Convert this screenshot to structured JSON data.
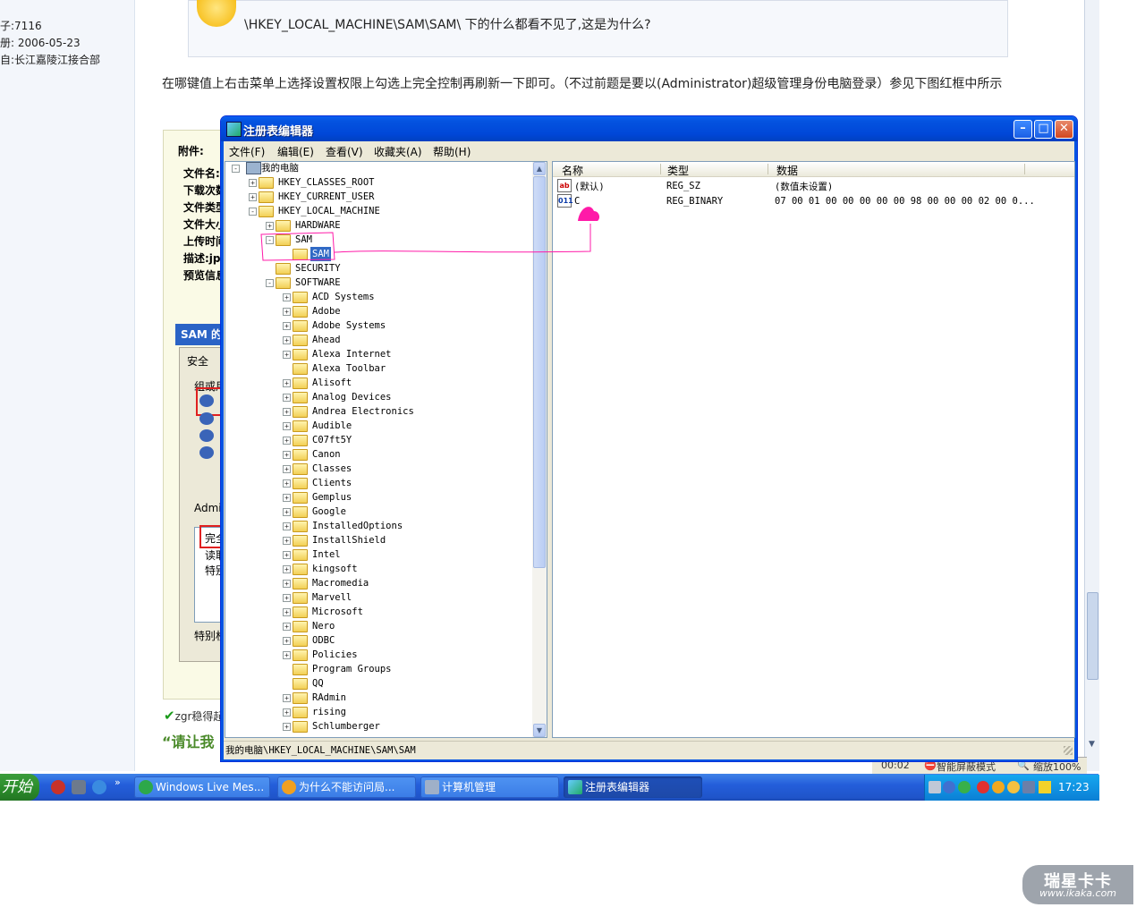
{
  "forum": {
    "user_meta": [
      "子:7116",
      "册: 2006-05-23",
      "自:长江嘉陵江接合部"
    ],
    "quote_text": "\\HKEY_LOCAL_MACHINE\\SAM\\SAM\\ 下的什么都看不见了,这是为什么?",
    "answer_text": "在哪键值上右击菜单上选择设置权限上勾选上完全控制再刷新一下即可。（不过前题是要以(Administrator)超级管理身份电脑登录）参见下图红框中所示",
    "attach_header": "附件:",
    "attach_labels": [
      "文件名:",
      "下载次数",
      "文件类型",
      "文件大小",
      "上传时间",
      "描述:jp",
      "预览信息"
    ],
    "sam_props_title": "SAM 的",
    "sam_tab": "安全",
    "sam_group": "组或用",
    "sam_admin": "Admin",
    "sam_perms": [
      "完全",
      "读取",
      "特别"
    ],
    "sam_special": "特别权",
    "reply_text": "zgr稳得起",
    "green_quote": "“请让我"
  },
  "ie_status": {
    "time": "00:02",
    "mode": "智能屏蔽模式",
    "zoom": "缩放100%"
  },
  "taskbar": {
    "start": "开始",
    "buttons": [
      {
        "label": "Windows Live Mes..."
      },
      {
        "label": "为什么不能访问局..."
      },
      {
        "label": "计算机管理"
      },
      {
        "label": "注册表编辑器"
      }
    ],
    "clock": "17:23"
  },
  "regedit": {
    "title": "注册表编辑器",
    "menu": [
      "文件(F)",
      "编辑(E)",
      "查看(V)",
      "收藏夹(A)",
      "帮助(H)"
    ],
    "tree": [
      {
        "label": "我的电脑",
        "depth": 0,
        "exp": "-"
      },
      {
        "label": "HKEY_CLASSES_ROOT",
        "depth": 1,
        "exp": "+"
      },
      {
        "label": "HKEY_CURRENT_USER",
        "depth": 1,
        "exp": "+"
      },
      {
        "label": "HKEY_LOCAL_MACHINE",
        "depth": 1,
        "exp": "-"
      },
      {
        "label": "HARDWARE",
        "depth": 2,
        "exp": "+"
      },
      {
        "label": "SAM",
        "depth": 2,
        "exp": "-"
      },
      {
        "label": "SAM",
        "depth": 3,
        "exp": "",
        "selected": true
      },
      {
        "label": "SECURITY",
        "depth": 2,
        "exp": ""
      },
      {
        "label": "SOFTWARE",
        "depth": 2,
        "exp": "-"
      },
      {
        "label": "ACD Systems",
        "depth": 3,
        "exp": "+"
      },
      {
        "label": "Adobe",
        "depth": 3,
        "exp": "+"
      },
      {
        "label": "Adobe Systems",
        "depth": 3,
        "exp": "+"
      },
      {
        "label": "Ahead",
        "depth": 3,
        "exp": "+"
      },
      {
        "label": "Alexa Internet",
        "depth": 3,
        "exp": "+"
      },
      {
        "label": "Alexa Toolbar",
        "depth": 3,
        "exp": ""
      },
      {
        "label": "Alisoft",
        "depth": 3,
        "exp": "+"
      },
      {
        "label": "Analog Devices",
        "depth": 3,
        "exp": "+"
      },
      {
        "label": "Andrea Electronics",
        "depth": 3,
        "exp": "+"
      },
      {
        "label": "Audible",
        "depth": 3,
        "exp": "+"
      },
      {
        "label": "C07ft5Y",
        "depth": 3,
        "exp": "+"
      },
      {
        "label": "Canon",
        "depth": 3,
        "exp": "+"
      },
      {
        "label": "Classes",
        "depth": 3,
        "exp": "+"
      },
      {
        "label": "Clients",
        "depth": 3,
        "exp": "+"
      },
      {
        "label": "Gemplus",
        "depth": 3,
        "exp": "+"
      },
      {
        "label": "Google",
        "depth": 3,
        "exp": "+"
      },
      {
        "label": "InstalledOptions",
        "depth": 3,
        "exp": "+"
      },
      {
        "label": "InstallShield",
        "depth": 3,
        "exp": "+"
      },
      {
        "label": "Intel",
        "depth": 3,
        "exp": "+"
      },
      {
        "label": "kingsoft",
        "depth": 3,
        "exp": "+"
      },
      {
        "label": "Macromedia",
        "depth": 3,
        "exp": "+"
      },
      {
        "label": "Marvell",
        "depth": 3,
        "exp": "+"
      },
      {
        "label": "Microsoft",
        "depth": 3,
        "exp": "+"
      },
      {
        "label": "Nero",
        "depth": 3,
        "exp": "+"
      },
      {
        "label": "ODBC",
        "depth": 3,
        "exp": "+"
      },
      {
        "label": "Policies",
        "depth": 3,
        "exp": "+"
      },
      {
        "label": "Program Groups",
        "depth": 3,
        "exp": ""
      },
      {
        "label": "QQ",
        "depth": 3,
        "exp": ""
      },
      {
        "label": "RAdmin",
        "depth": 3,
        "exp": "+"
      },
      {
        "label": "rising",
        "depth": 3,
        "exp": "+"
      },
      {
        "label": "Schlumberger",
        "depth": 3,
        "exp": "+"
      }
    ],
    "columns": [
      "名称",
      "类型",
      "数据"
    ],
    "values": [
      {
        "icon": "ab",
        "name": "(默认)",
        "type": "REG_SZ",
        "data": "(数值未设置)"
      },
      {
        "icon": "011",
        "name": "C",
        "type": "REG_BINARY",
        "data": "07 00 01 00 00 00 00 00 98 00 00 00 02 00 0..."
      }
    ],
    "status_path": "我的电脑\\HKEY_LOCAL_MACHINE\\SAM\\SAM"
  },
  "watermark": {
    "title": "瑞星卡卡",
    "url": "www.ikaka.com"
  },
  "colors": {
    "annotation": "#ff1aa8",
    "title_bar": "#0453e0",
    "selection": "#316ac5",
    "taskbar": "#245edb",
    "start": "#2a8a2a"
  }
}
